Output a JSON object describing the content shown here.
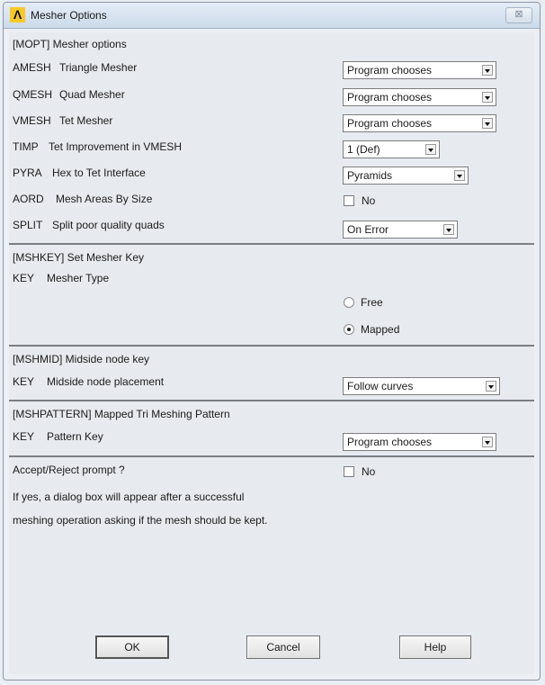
{
  "window": {
    "title": "Mesher Options",
    "close_label": "⊠"
  },
  "mopt": {
    "header": "[MOPT]  Mesher options",
    "rows": [
      {
        "code": "AMESH",
        "label": "Triangle Mesher",
        "value": "Program chooses"
      },
      {
        "code": "QMESH",
        "label": "Quad Mesher",
        "value": "Program chooses"
      },
      {
        "code": "VMESH",
        "label": "Tet Mesher",
        "value": "Program chooses"
      },
      {
        "code": "TIMP",
        "label": "Tet Improvement in VMESH",
        "value": "1 (Def)"
      },
      {
        "code": "PYRA",
        "label": "Hex to Tet Interface",
        "value": "Pyramids"
      },
      {
        "code": "AORD",
        "label": "Mesh Areas By Size",
        "value": "No",
        "checked": false
      },
      {
        "code": "SPLIT",
        "label": "Split poor quality quads",
        "value": "On Error"
      }
    ]
  },
  "mshkey": {
    "header": "[MSHKEY]  Set Mesher Key",
    "code": "KEY",
    "label": "Mesher Type",
    "options": [
      {
        "label": "Free",
        "selected": false
      },
      {
        "label": "Mapped",
        "selected": true
      }
    ]
  },
  "mshmid": {
    "header": "[MSHMID]  Midside node key",
    "code": "KEY",
    "label": "Midside node placement",
    "value": "Follow curves"
  },
  "mshpattern": {
    "header": "[MSHPATTERN]  Mapped Tri Meshing Pattern",
    "code": "KEY",
    "label": "Pattern Key",
    "value": "Program chooses"
  },
  "prompt": {
    "label": "Accept/Reject prompt ?",
    "value": "No",
    "checked": false,
    "note_line1": "If yes, a dialog box will appear after a successful",
    "note_line2": "meshing operation asking if the mesh should be kept."
  },
  "buttons": {
    "ok": "OK",
    "cancel": "Cancel",
    "help": "Help"
  }
}
